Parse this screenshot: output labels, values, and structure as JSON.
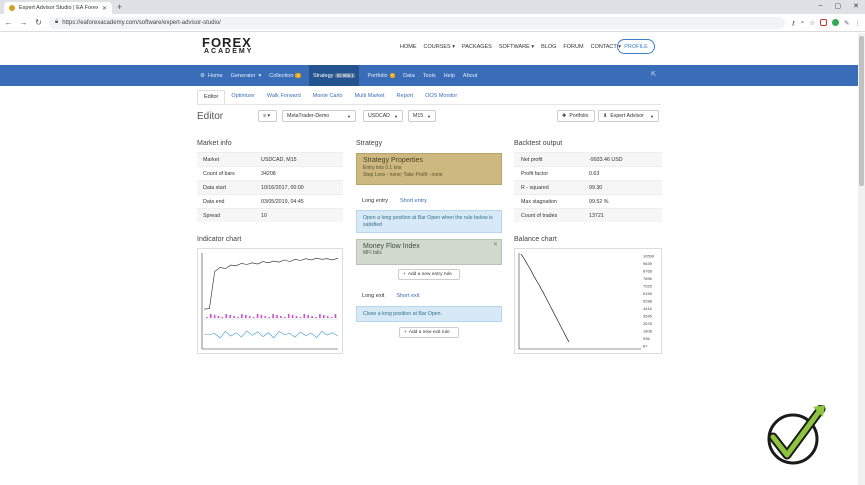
{
  "browser": {
    "tab_title": "Expert Advisor Studio | EA Forex",
    "url": "https://eaforexacademy.com/software/expert-advisor-studio/"
  },
  "site": {
    "logo_top": "FOREX",
    "logo_bottom": "ACADEMY",
    "nav": [
      "HOME",
      "COURSES ▾",
      "PACKAGES",
      "SOFTWARE ▾",
      "BLOG",
      "FORUM",
      "CONTACT ▾"
    ],
    "profile_label": "PROFILE"
  },
  "appnav": {
    "home": "Home",
    "generator": "Generator",
    "collection": "Collection",
    "collection_badge": "0",
    "strategy": "Strategy",
    "strategy_id": "ID 955.1",
    "portfolio": "Portfolio",
    "portfolio_badge": "0",
    "data": "Data",
    "tools": "Tools",
    "help": "Help",
    "about": "About"
  },
  "subtabs": [
    "Editor",
    "Optimizer",
    "Walk Forward",
    "Monte Carlo",
    "Multi Market",
    "Report",
    "OOS Monitor"
  ],
  "toolbar": {
    "title": "Editor",
    "menu_icon": "≡ ▾",
    "broker": "MetaTrader-Demo",
    "symbol": "USDCAD",
    "period": "M15",
    "portfolio_btn": "Portfolio",
    "expert_btn": "Expert Advisor"
  },
  "market_info": {
    "title": "Market info",
    "rows": [
      {
        "k": "Market",
        "v": "USDCAD, M15"
      },
      {
        "k": "Count of bars",
        "v": "34208"
      },
      {
        "k": "Data start",
        "v": "10/16/2017, 00:00"
      },
      {
        "k": "Data end",
        "v": "03/05/2019, 04:45"
      },
      {
        "k": "Spread",
        "v": "10"
      }
    ]
  },
  "strategy": {
    "title": "Strategy",
    "props_title": "Strategy Properties",
    "props_line1": "Entry lots 0.1 lots",
    "props_line2": "Stop Loss - none; Take Profit - none",
    "long_entry": "Long entry",
    "short_entry": "Short entry",
    "entry_info": "Open a long position at Bar Open when the rule below is satisfied",
    "indicator_title": "Money Flow Index",
    "indicator_sub": "MFI falls",
    "add_entry": "Add a new entry rule",
    "long_exit": "Long exit",
    "short_exit": "Short exit",
    "exit_info": "Close a long position at Bar Open.",
    "add_exit": "Add a new exit rule"
  },
  "backtest": {
    "title": "Backtest output",
    "rows": [
      {
        "k": "Net profit",
        "v": "-9933.46 USD"
      },
      {
        "k": "Profit factor",
        "v": "0.63"
      },
      {
        "k": "R - squared",
        "v": "99.30"
      },
      {
        "k": "Max stagnation",
        "v": "99.52 %"
      },
      {
        "k": "Count of trades",
        "v": "13721"
      }
    ]
  },
  "indicator_chart_title": "Indicator chart",
  "balance_chart_title": "Balance chart",
  "chart_data": [
    {
      "type": "line",
      "title": "Balance chart",
      "yticks": [
        "10590",
        "9639",
        "8768",
        "7896",
        "7025",
        "6159",
        "5288",
        "4416",
        "3545",
        "2678",
        "1808",
        "936",
        "67"
      ],
      "series": [
        {
          "values": [
            10590,
            10300,
            9950,
            9600,
            9250,
            8900,
            8500,
            8100,
            7750,
            7400,
            7050,
            6650,
            6300,
            5900,
            5500,
            5100,
            4700,
            4300,
            3900,
            3500,
            3100,
            2700,
            2300,
            1900,
            1500,
            1100,
            750
          ]
        }
      ]
    },
    {
      "type": "line",
      "title": "Indicator chart",
      "series": [
        {
          "values": [
            10,
            11,
            75,
            82,
            80,
            86,
            85,
            89,
            87,
            90,
            88,
            92,
            90,
            93,
            91,
            95,
            92,
            96,
            94,
            97,
            95,
            98,
            96,
            97,
            95,
            98
          ]
        },
        {
          "values": [
            50,
            48,
            52,
            35,
            60,
            42,
            55,
            38,
            62,
            45,
            58,
            40,
            55,
            35,
            60,
            48,
            52,
            38,
            58,
            44,
            54,
            36,
            60,
            46,
            55,
            42
          ]
        }
      ]
    }
  ],
  "colors": {
    "appnav": "#3a6db8",
    "strategy_props": "#cdb980",
    "indicator_block": "#d2dad0",
    "info_box": "#d7e9f7",
    "check_green": "#8cc63e"
  }
}
